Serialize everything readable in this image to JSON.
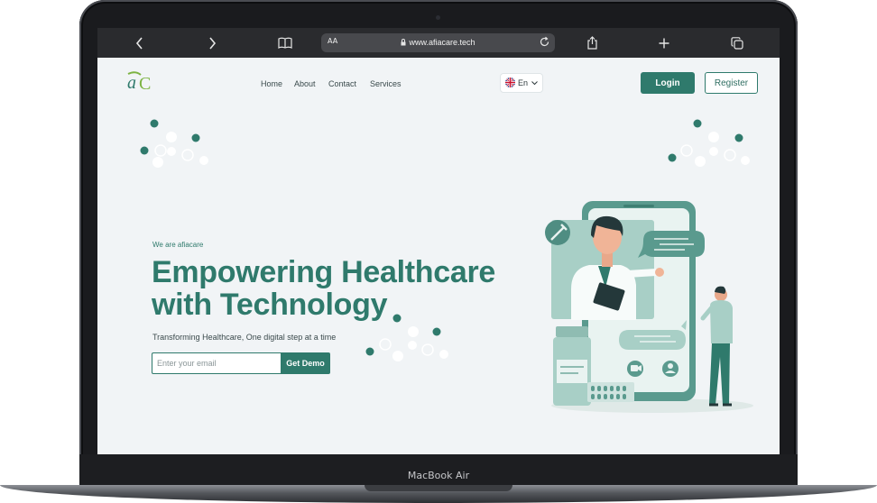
{
  "device": {
    "label": "MacBook Air"
  },
  "browser": {
    "url": "www.afiacare.tech",
    "text_size_label": "AA",
    "icons": {
      "back": "chevron-left-icon",
      "forward": "chevron-right-icon",
      "bookmarks": "book-icon",
      "lock": "lock-icon",
      "reload": "reload-icon",
      "share": "share-icon",
      "new_tab": "plus-icon",
      "tabs": "tabs-icon"
    }
  },
  "site": {
    "logo_text": "aC",
    "nav": [
      {
        "label": "Home"
      },
      {
        "label": "About"
      },
      {
        "label": "Contact"
      },
      {
        "label": "Services"
      }
    ],
    "language": {
      "label": "En",
      "flag": "uk-flag-icon"
    },
    "login_label": "Login",
    "register_label": "Register"
  },
  "hero": {
    "eyebrow": "We are afiacare",
    "title_line1": "Empowering Healthcare",
    "title_line2": "with Technology",
    "subtitle": "Transforming Healthcare, One digital step at a time",
    "email_placeholder": "Enter your email",
    "cta_label": "Get Demo"
  },
  "colors": {
    "brand": "#2f7a6c",
    "brand_light": "#a8cfc6",
    "page_bg": "#f1f4f6"
  }
}
